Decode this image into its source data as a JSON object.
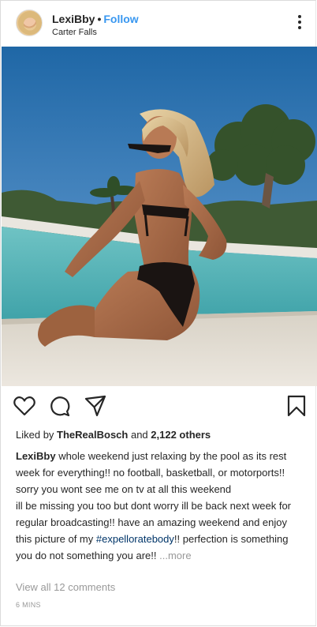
{
  "header": {
    "username": "LexiBby",
    "separator": "•",
    "follow_label": "Follow",
    "location": "Carter Falls"
  },
  "icons": [
    "more-options-icon",
    "heart-icon",
    "comment-icon",
    "share-icon",
    "bookmark-icon"
  ],
  "likes": {
    "prefix": "Liked by ",
    "user": "TheRealBosch",
    "middle": " and ",
    "count": "2,122 others"
  },
  "caption": {
    "username": "LexiBby",
    "line1": " whole weekend just relaxing by the pool as its rest week for everything!! no football, basketball, or motorports!! sorry you wont see me on tv at all this weekend",
    "line2_pre": "ill be missing you too but dont worry ill be back next week for regular broadcasting!! have an amazing weekend and enjoy this picture of my ",
    "hashtag": "#expelloratebody",
    "line2_post": "!! perfection is something you do not something you are!!  ",
    "more": "...more"
  },
  "comments_link": "View all 12 comments",
  "timestamp": "6 MINS",
  "colors": {
    "link_blue": "#3897f0",
    "hashtag": "#003569",
    "muted": "#999999",
    "text": "#262626"
  }
}
